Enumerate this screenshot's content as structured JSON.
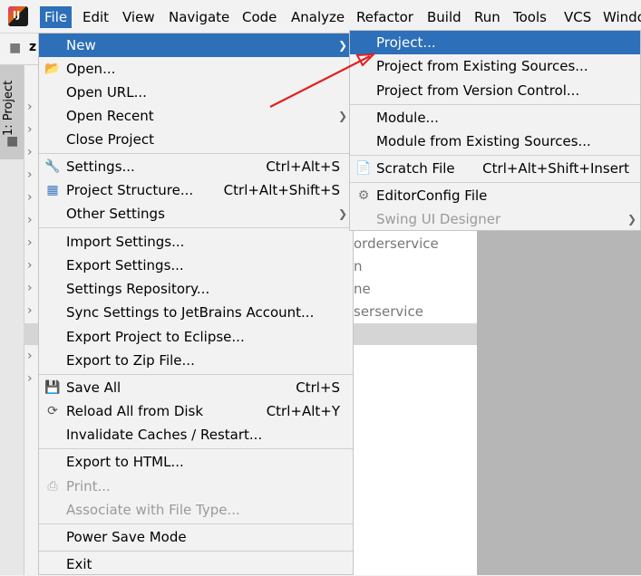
{
  "menubar": {
    "logo_text": "IJ",
    "items": [
      "File",
      "Edit",
      "View",
      "Navigate",
      "Code",
      "Analyze",
      "Refactor",
      "Build",
      "Run",
      "Tools",
      "VCS",
      "Windo"
    ]
  },
  "left": {
    "tab_label": "1: Project",
    "fragments": [
      "z"
    ]
  },
  "tree_fragments": [
    "orderservice",
    "n",
    "ne",
    "serservice"
  ],
  "file_menu": {
    "new": "New",
    "open": "Open...",
    "open_url": "Open URL...",
    "open_recent": "Open Recent",
    "close_project": "Close Project",
    "settings": "Settings...",
    "settings_sc": "Ctrl+Alt+S",
    "project_structure": "Project Structure...",
    "project_structure_sc": "Ctrl+Alt+Shift+S",
    "other_settings": "Other Settings",
    "import_settings": "Import Settings...",
    "export_settings": "Export Settings...",
    "settings_repository": "Settings Repository...",
    "sync_settings": "Sync Settings to JetBrains Account...",
    "export_eclipse": "Export Project to Eclipse...",
    "export_zip": "Export to Zip File...",
    "save_all": "Save All",
    "save_all_sc": "Ctrl+S",
    "reload": "Reload All from Disk",
    "reload_sc": "Ctrl+Alt+Y",
    "invalidate": "Invalidate Caches / Restart...",
    "export_html": "Export to HTML...",
    "print": "Print...",
    "associate": "Associate with File Type...",
    "power_save": "Power Save Mode",
    "exit": "Exit"
  },
  "new_menu": {
    "project": "Project...",
    "project_existing": "Project from Existing Sources...",
    "project_vcs": "Project from Version Control...",
    "module": "Module...",
    "module_existing": "Module from Existing Sources...",
    "scratch": "Scratch File",
    "scratch_sc": "Ctrl+Alt+Shift+Insert",
    "editorconfig": "EditorConfig File",
    "swing": "Swing UI Designer"
  },
  "colors": {
    "highlight": "#2d6fb8",
    "arrow_annotation": "#e02020"
  }
}
